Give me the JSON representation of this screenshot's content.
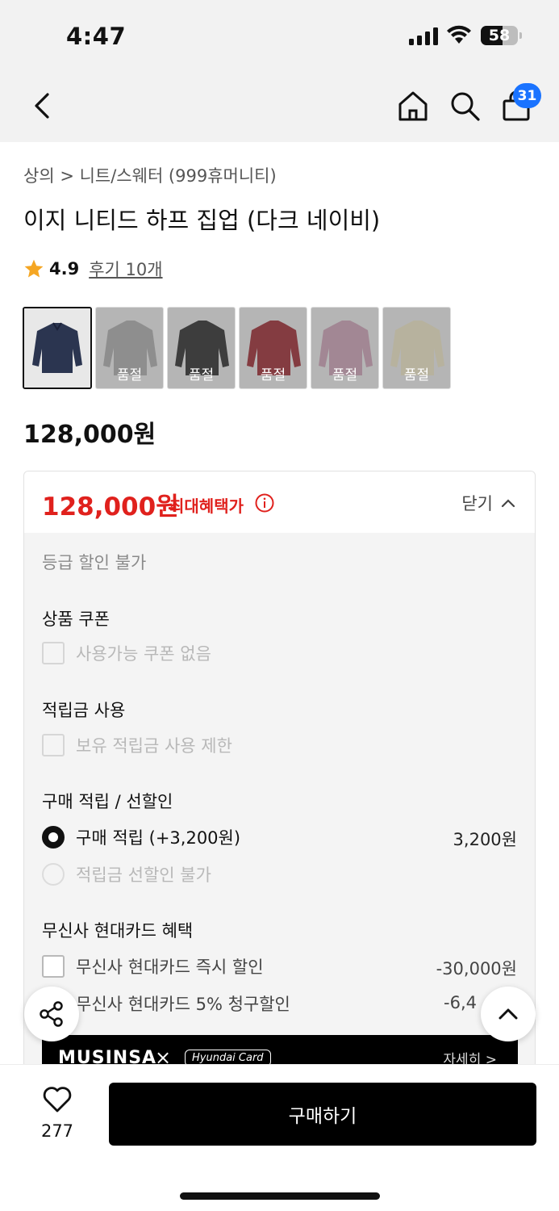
{
  "status": {
    "time": "4:47",
    "battery": "58"
  },
  "nav": {
    "cart_badge": "31",
    "icons": [
      "back-icon",
      "home-icon",
      "search-icon",
      "bag-icon"
    ]
  },
  "product": {
    "breadcrumb": "상의 > 니트/스웨터 (999휴머니티)",
    "title": "이지 니티드 하프 집업 (다크 네이비)",
    "rating": "4.9",
    "reviews": "후기 10개",
    "price": "128,000원",
    "thumbnails": [
      {
        "color": "#2b3550",
        "soldout": ""
      },
      {
        "color": "#9a9a9a",
        "soldout": "품절"
      },
      {
        "color": "#1e1e1e",
        "soldout": "품절"
      },
      {
        "color": "#8a1c24",
        "soldout": "품절"
      },
      {
        "color": "#b98fa3",
        "soldout": "품절"
      },
      {
        "color": "#d9d2b2",
        "soldout": "품절"
      }
    ]
  },
  "benefit": {
    "max_price": "128,000원",
    "max_label": "최대혜택가",
    "close_label": "닫기",
    "grade_note": "등급 할인 불가",
    "coupon_title": "상품 쿠폰",
    "coupon_option": "사용가능 쿠폰 없음",
    "points_title": "적립금 사용",
    "points_option": "보유 적립금 사용 제한",
    "purchase_title": "구매 적립 / 선할인",
    "purchase_option": "구매 적립 (+3,200원)",
    "purchase_amount": "3,200원",
    "prediscount_option": "적립금 선할인 불가",
    "card_title": "무신사 현대카드 혜택",
    "card_instant": "무신사 현대카드 즉시 할인",
    "card_instant_amount": "-30,000원",
    "card_claim": "무신사 현대카드 5% 청구할인",
    "card_claim_amount": "-6,4",
    "banner_brand": "MUSINSA",
    "banner_x": "×",
    "banner_card": "Hyundai Card",
    "banner_detail": "자세히 >"
  },
  "bottom": {
    "likes": "277",
    "buy_label": "구매하기"
  },
  "colors": {
    "accent_red": "#e0211d",
    "badge_blue": "#1a73ff",
    "star": "#f5a623"
  }
}
